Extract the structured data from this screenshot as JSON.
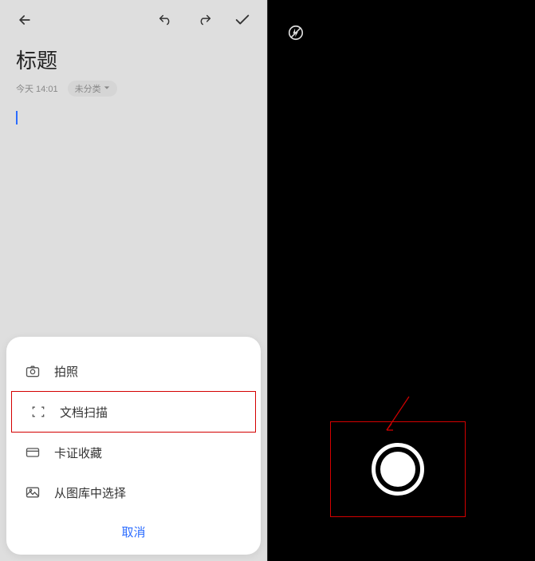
{
  "editor": {
    "title": "标题",
    "timestamp": "今天 14:01",
    "category": "未分类"
  },
  "sheet": {
    "options": [
      {
        "icon": "camera",
        "label": "拍照"
      },
      {
        "icon": "scan",
        "label": "文档扫描"
      },
      {
        "icon": "card",
        "label": "卡证收藏"
      },
      {
        "icon": "gallery",
        "label": "从图库中选择"
      }
    ],
    "cancel": "取消",
    "highlighted_index": 1
  },
  "colors": {
    "accent": "#2b6cff",
    "highlight_border": "#d40000"
  }
}
